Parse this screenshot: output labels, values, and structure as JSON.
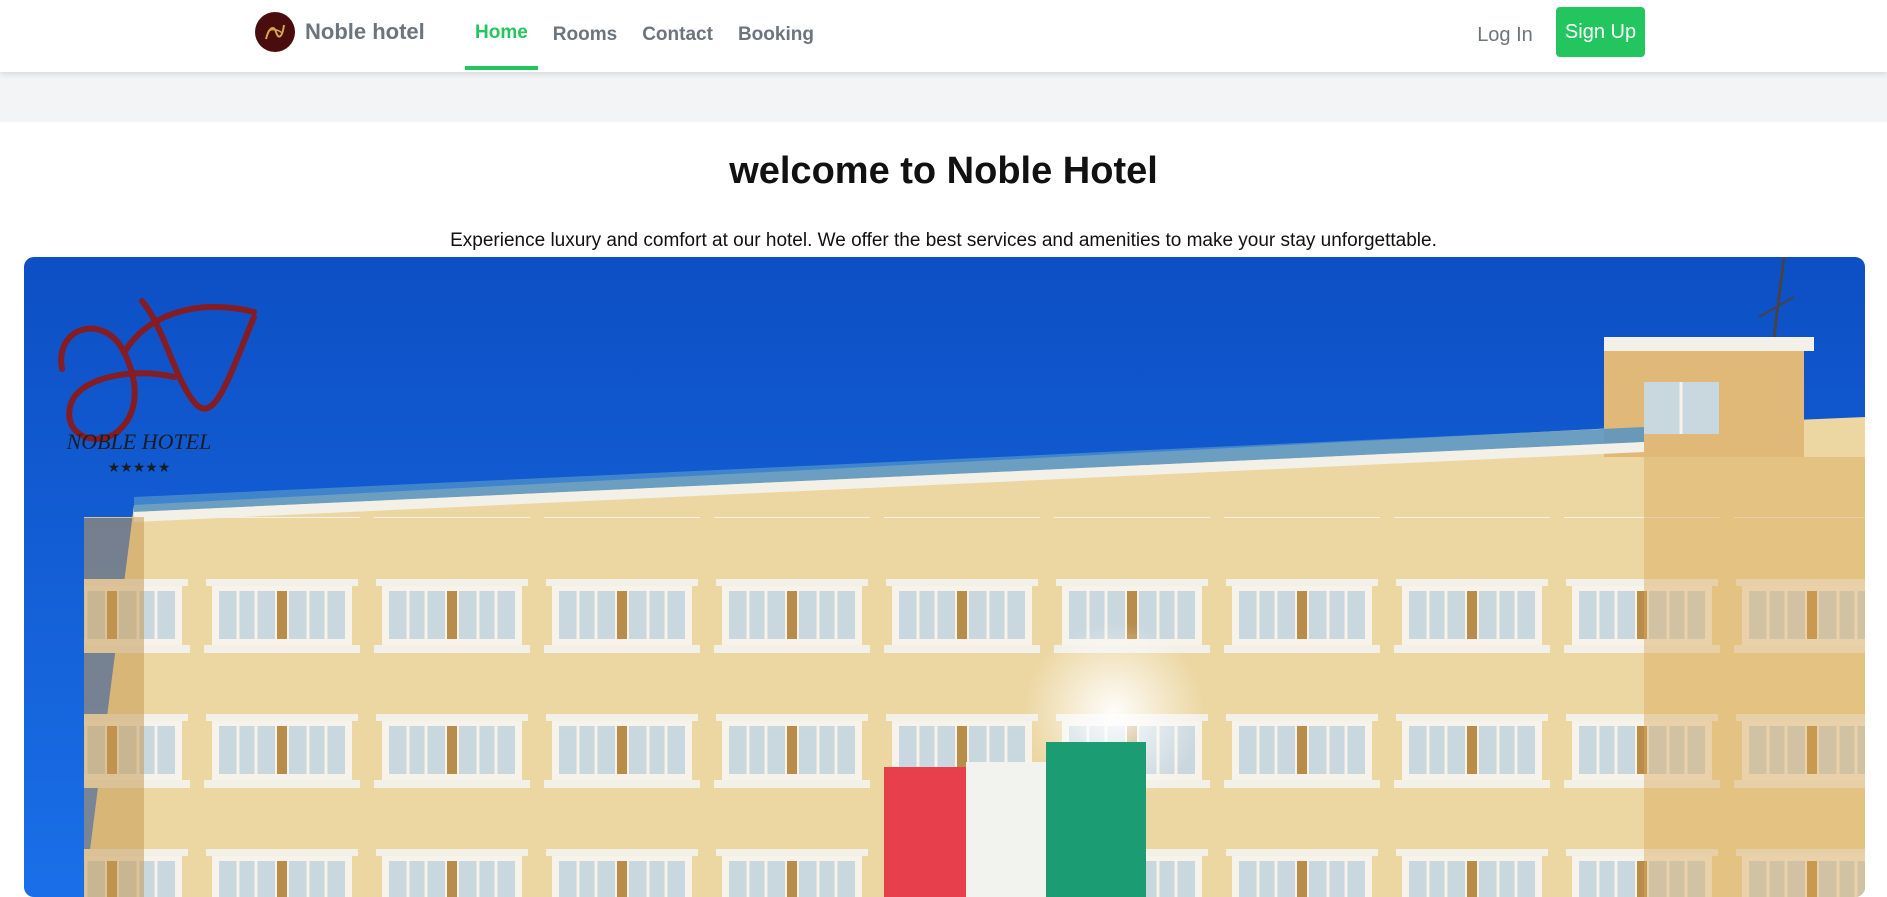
{
  "brand": {
    "name": "Noble hotel",
    "logo_icon": "noble-hotel-logo-icon"
  },
  "nav": {
    "items": [
      {
        "label": "Home",
        "active": true
      },
      {
        "label": "Rooms",
        "active": false
      },
      {
        "label": "Contact",
        "active": false
      },
      {
        "label": "Booking",
        "active": false
      }
    ]
  },
  "auth": {
    "login_label": "Log In",
    "signup_label": "Sign Up"
  },
  "hero": {
    "title": "welcome to Noble Hotel",
    "subtitle": "Experience luxury and comfort at our hotel. We offer the best services and amenities to make your stay unforgettable.",
    "watermark_text": "NOBLE HOTEL",
    "watermark_stars": "★★★★★"
  },
  "colors": {
    "accent": "#22c55e",
    "brand_dark": "#4a0d0d",
    "text_muted": "#6c757d",
    "sky": "#1560d6",
    "facade": "#ecd7a3"
  }
}
